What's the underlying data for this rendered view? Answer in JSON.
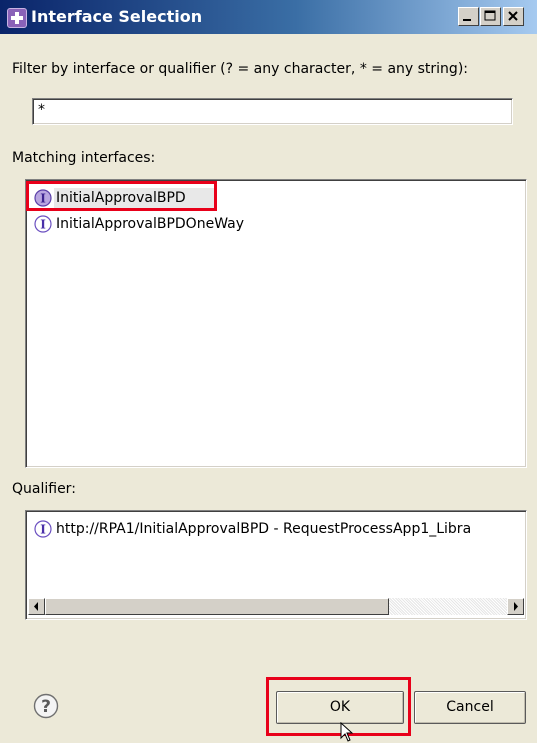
{
  "dialog": {
    "title": "Interface Selection"
  },
  "filter": {
    "label": "Filter by interface or qualifier (? = any character, * = any string):",
    "value": "*"
  },
  "matching": {
    "label": "Matching interfaces:",
    "items": [
      {
        "label": "InitialApprovalBPD",
        "icon": "interface-icon",
        "selected": true
      },
      {
        "label": "InitialApprovalBPDOneWay",
        "icon": "interface-icon",
        "selected": false
      }
    ]
  },
  "qualifier": {
    "label": "Qualifier:",
    "items": [
      {
        "label": "http://RPA1/InitialApprovalBPD - RequestProcessApp1_Libra",
        "icon": "interface-icon"
      }
    ]
  },
  "buttons": {
    "ok": "OK",
    "cancel": "Cancel",
    "help_icon": "help-icon"
  },
  "colors": {
    "highlight": "#e8001a",
    "title_bar": "#0a246a",
    "interface_icon": "#7b5fbf"
  }
}
